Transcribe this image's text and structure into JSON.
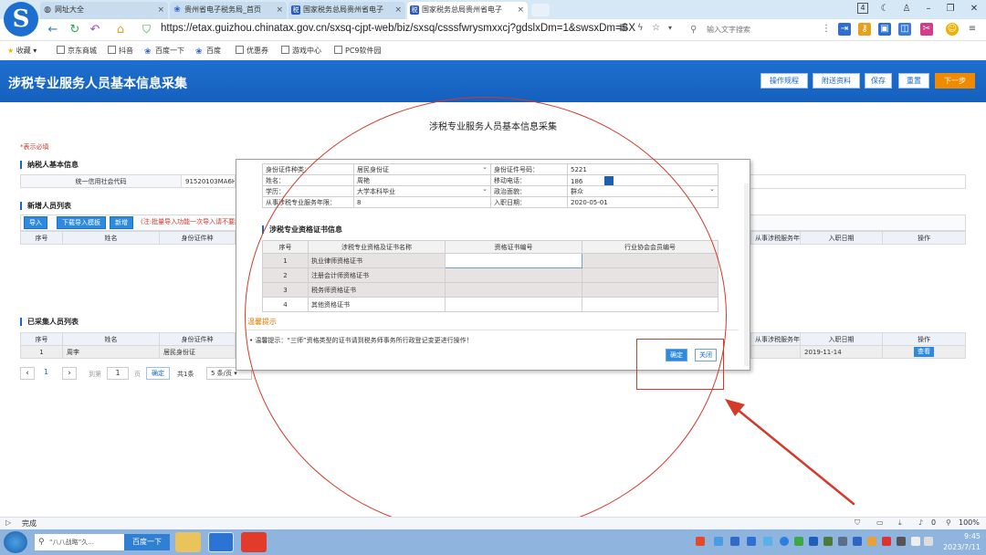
{
  "browser": {
    "tabs": [
      {
        "label": "网址大全",
        "icon": "globe-icon"
      },
      {
        "label": "贵州省电子税务局_首页",
        "icon": "paw-icon"
      },
      {
        "label": "国家税务总局贵州省电子",
        "icon": "tax-icon"
      },
      {
        "label": "国家税务总局贵州省电子",
        "icon": "tax-icon"
      }
    ],
    "tab_count": "4",
    "url": "https://etax.guizhou.chinatax.gov.cn/sxsq-cjpt-web/biz/sxsq/csssfwrysmxxcj?gdslxDm=1&swsxDm=SX",
    "search_placeholder": "输入文字搜索",
    "bookmarks": [
      "收藏",
      "京东商城",
      "抖音",
      "百度一下",
      "百度",
      "优惠券",
      "游戏中心",
      "PC9软件园"
    ],
    "status_text": "完成",
    "zoom": "100%",
    "status_count": "0"
  },
  "page": {
    "title": "涉税专业服务人员基本信息采集",
    "header_buttons": [
      "操作规程",
      "附送资料",
      "保存",
      "重置",
      "下一步"
    ],
    "required_note": "*表示必填",
    "section_taxpayer": "纳税人基本信息",
    "credit_code_label": "统一信用社会代码",
    "credit_code_value": "91520103MA6HF",
    "section_new": "新增人员列表",
    "new_buttons": [
      "导入",
      "下载导入模板",
      "新增"
    ],
    "import_note": "(注:批量导入功能一次导入请不要超",
    "new_columns": [
      "序号",
      "姓名",
      "身份证件种"
    ],
    "right_columns": [
      "从事涉税服务年限",
      "入职日期",
      "操作"
    ],
    "section_collected": "已采集人员列表",
    "collected_columns": [
      "序号",
      "姓名",
      "身份证件种"
    ],
    "collected_row": {
      "index": "1",
      "name": "周李",
      "id_type": "居民身份证",
      "entry_date": "2019-11-14",
      "action": "查看"
    },
    "pager": {
      "page": "1",
      "goto_label": "到第",
      "page_input": "1",
      "page_unit": "页",
      "confirm": "确定",
      "total": "共1条",
      "page_size": "5 条/页"
    }
  },
  "dialog": {
    "title": "涉税专业服务人员基本信息采集",
    "fields": {
      "id_type_label": "身份证件种类：",
      "id_type_value": "居民身份证",
      "id_no_label": "身份证件号码：",
      "id_no_value": "5221",
      "name_label": "姓名：",
      "name_value": "周艳",
      "phone_label": "移动电话：",
      "phone_value": "186",
      "edu_label": "学历：",
      "edu_value": "大学本科毕业",
      "politics_label": "政治面貌：",
      "politics_value": "群众",
      "years_label": "从事涉税专业服务年限：",
      "years_value": "8",
      "entry_label": "入职日期：",
      "entry_value": "2020-05-01"
    },
    "cert_section": "涉税专业资格证书信息",
    "cert_columns": [
      "序号",
      "涉税专业资格及证书名称",
      "资格证书编号",
      "行业协会会员编号"
    ],
    "certs": [
      {
        "index": "1",
        "name": "执业律师资格证书"
      },
      {
        "index": "2",
        "name": "注册会计师资格证书"
      },
      {
        "index": "3",
        "name": "税务师资格证书"
      },
      {
        "index": "4",
        "name": "其他资格证书"
      }
    ],
    "tip_title": "温馨提示",
    "tip_text": "温馨提示：“三师”资格类型的证书请到税务师事务所行政登记变更进行操作！",
    "confirm": "确定",
    "close": "关闭"
  },
  "taskbar": {
    "search_text": "“八八战略”久...",
    "search_button": "百度一下",
    "time": "9:45",
    "date": "2023/7/11"
  },
  "colors": {
    "header_blue": "#1560bd",
    "accent_orange": "#f08a00",
    "annotation_red": "#d23a2a"
  }
}
